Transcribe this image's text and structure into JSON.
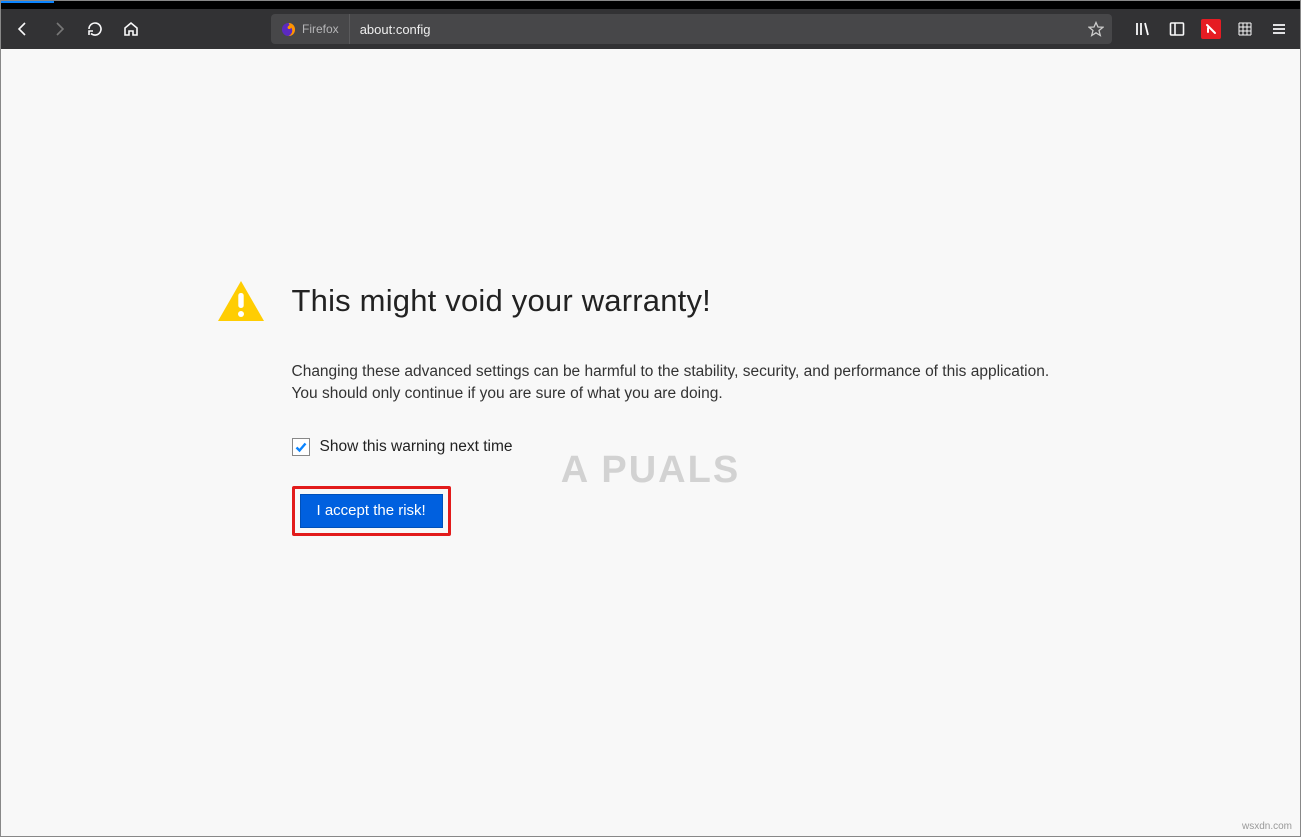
{
  "browser": {
    "identity_label": "Firefox",
    "url": "about:config"
  },
  "page": {
    "title": "This might void your warranty!",
    "body": "Changing these advanced settings can be harmful to the stability, security, and performance of this application. You should only continue if you are sure of what you are doing.",
    "checkbox_label": "Show this warning next time",
    "checkbox_checked": true,
    "accept_label": "I accept the risk!"
  },
  "watermark": "A  PUALS",
  "attribution": "wsxdn.com"
}
